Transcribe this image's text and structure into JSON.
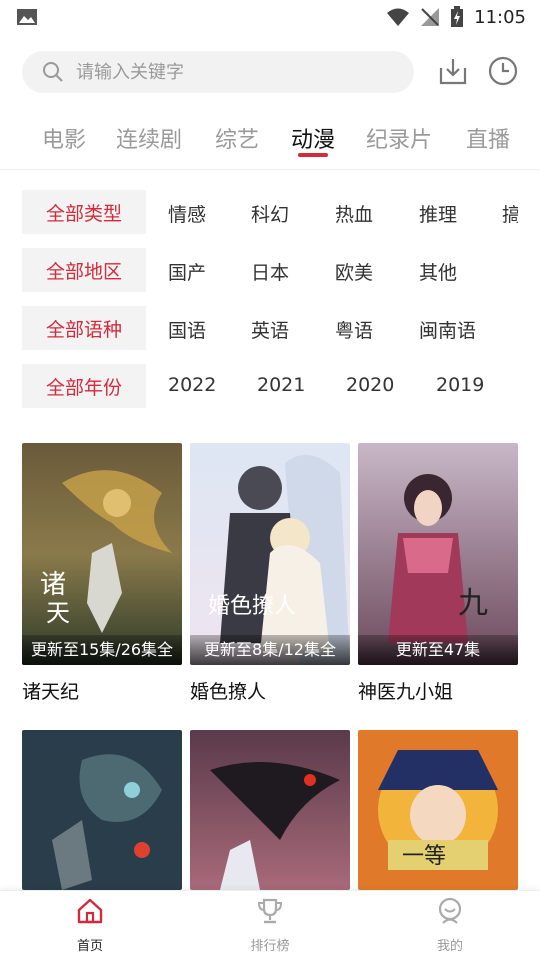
{
  "status": {
    "time": "11:05"
  },
  "search": {
    "placeholder": "请输入关键字"
  },
  "tabs": [
    "电影",
    "连续剧",
    "综艺",
    "动漫",
    "纪录片",
    "直播"
  ],
  "filters": [
    {
      "all": "全部类型",
      "options": [
        "情感",
        "科幻",
        "热血",
        "推理",
        "搞"
      ]
    },
    {
      "all": "全部地区",
      "options": [
        "国产",
        "日本",
        "欧美",
        "其他"
      ]
    },
    {
      "all": "全部语种",
      "options": [
        "国语",
        "英语",
        "粤语",
        "闽南语"
      ]
    },
    {
      "all": "全部年份",
      "options": [
        "2022",
        "2021",
        "2020",
        "2019"
      ]
    }
  ],
  "cards": [
    {
      "title": "诸天纪",
      "badge": "更新至15集/26集全"
    },
    {
      "title": "婚色撩人",
      "badge": "更新至8集/12集全"
    },
    {
      "title": "神医九小姐",
      "badge": "更新至47集"
    },
    {
      "title": "",
      "badge": ""
    },
    {
      "title": "",
      "badge": ""
    },
    {
      "title": "",
      "badge": ""
    }
  ],
  "nav": {
    "home": "首页",
    "rank": "排行榜",
    "mine": "我的"
  },
  "colors": {
    "accent": "#d32b3c"
  }
}
